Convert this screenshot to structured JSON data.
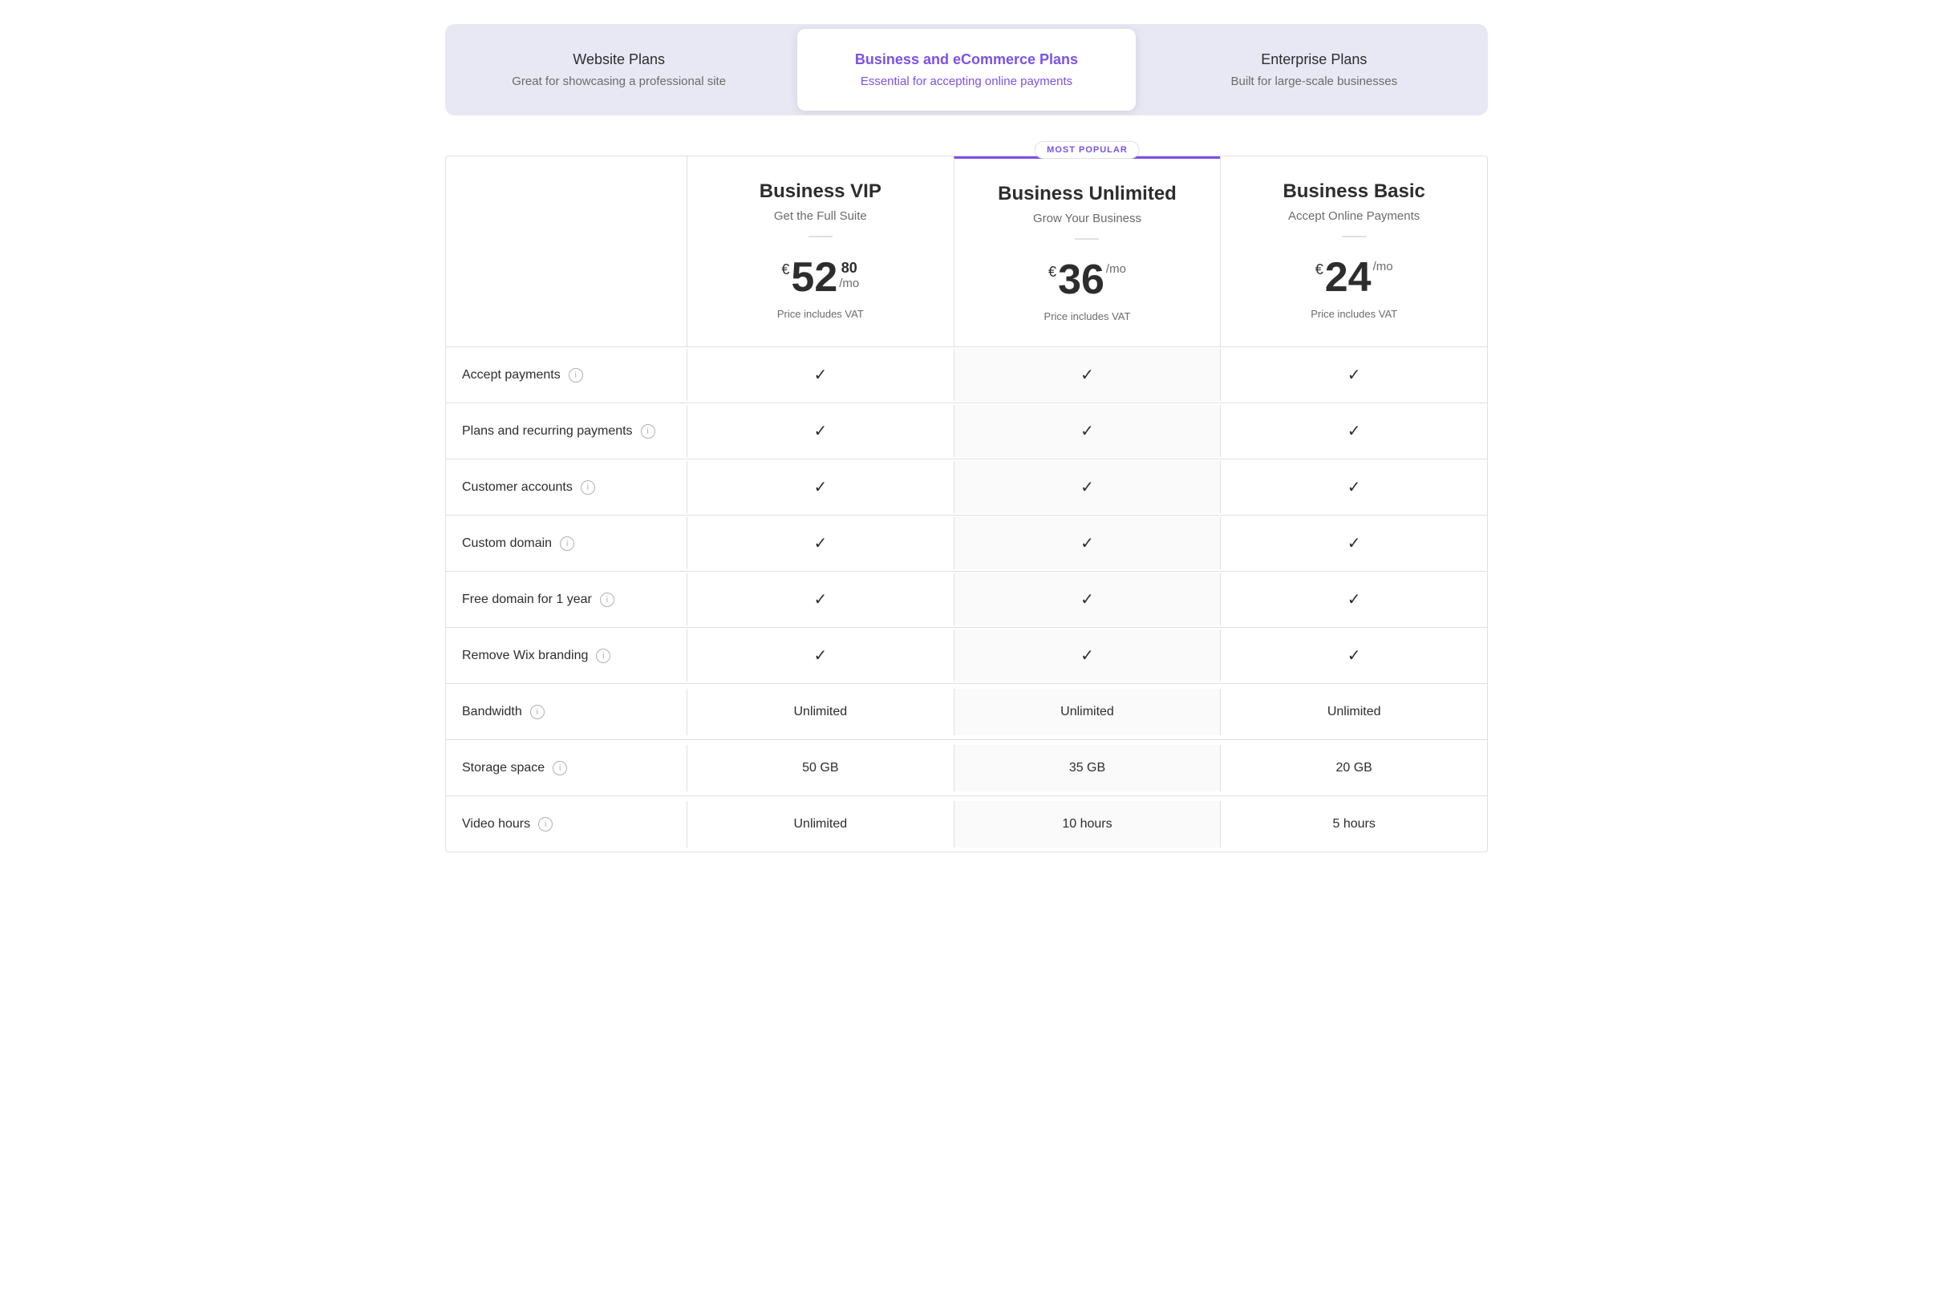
{
  "tabs": [
    {
      "id": "website",
      "title": "Website Plans",
      "subtitle": "Great for showcasing a professional site",
      "active": false
    },
    {
      "id": "business",
      "title": "Business and eCommerce Plans",
      "subtitle": "Essential for accepting online payments",
      "active": true
    },
    {
      "id": "enterprise",
      "title": "Enterprise Plans",
      "subtitle": "Built for large-scale businesses",
      "active": false
    }
  ],
  "most_popular_label": "MOST POPULAR",
  "plans": [
    {
      "id": "vip",
      "name": "Business VIP",
      "tagline": "Get the Full Suite",
      "price_currency": "€",
      "price_amount": "52",
      "price_decimal": "80",
      "price_mo": "/mo",
      "price_vat": "Price includes VAT",
      "featured": false
    },
    {
      "id": "unlimited",
      "name": "Business Unlimited",
      "tagline": "Grow Your Business",
      "price_currency": "€",
      "price_amount": "36",
      "price_decimal": "",
      "price_mo": "/mo",
      "price_vat": "Price includes VAT",
      "featured": true
    },
    {
      "id": "basic",
      "name": "Business Basic",
      "tagline": "Accept Online Payments",
      "price_currency": "€",
      "price_amount": "24",
      "price_decimal": "",
      "price_mo": "/mo",
      "price_vat": "Price includes VAT",
      "featured": false
    }
  ],
  "features": [
    {
      "label": "Accept payments",
      "values": [
        "check",
        "check",
        "check"
      ]
    },
    {
      "label": "Plans and recurring payments",
      "values": [
        "check",
        "check",
        "check"
      ]
    },
    {
      "label": "Customer accounts",
      "values": [
        "check",
        "check",
        "check"
      ]
    },
    {
      "label": "Custom domain",
      "values": [
        "check",
        "check",
        "check"
      ]
    },
    {
      "label": "Free domain for 1 year",
      "values": [
        "check",
        "check",
        "check"
      ]
    },
    {
      "label": "Remove Wix branding",
      "values": [
        "check",
        "check",
        "check"
      ]
    },
    {
      "label": "Bandwidth",
      "values": [
        "Unlimited",
        "Unlimited",
        "Unlimited"
      ]
    },
    {
      "label": "Storage space",
      "values": [
        "50 GB",
        "35 GB",
        "20 GB"
      ]
    },
    {
      "label": "Video hours",
      "values": [
        "Unlimited",
        "10 hours",
        "5 hours"
      ]
    }
  ]
}
